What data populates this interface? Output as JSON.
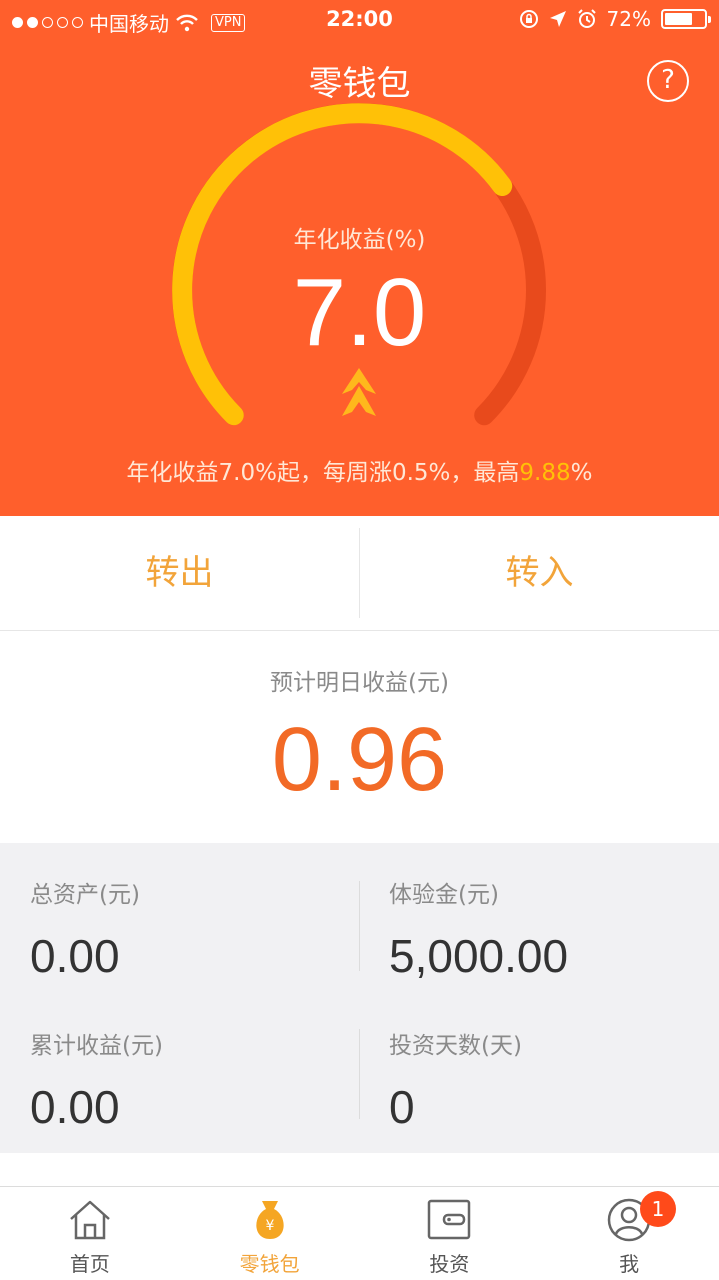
{
  "status_bar": {
    "carrier": "中国移动",
    "vpn": "VPN",
    "time": "22:00",
    "battery": "72%",
    "battery_level": 0.72
  },
  "header": {
    "title": "零钱包",
    "help_icon": "question-circle-icon"
  },
  "gauge": {
    "label": "年化收益(%)",
    "value": "7.0",
    "fill_fraction": 0.7,
    "note_prefix": "年化收益7.0%起，每周涨0.5%，最高",
    "note_highlight": "9.88",
    "note_suffix": "%",
    "colors": {
      "active": "#ffc107",
      "inactive": "#e84a1c"
    }
  },
  "actions": {
    "withdraw": "转出",
    "deposit": "转入"
  },
  "estimate": {
    "label": "预计明日收益(元)",
    "value": "0.96"
  },
  "stats": {
    "total_assets": {
      "label": "总资产(元)",
      "value": "0.00"
    },
    "trial_funds": {
      "label": "体验金(元)",
      "value": "5,000.00"
    },
    "cumulative_earnings": {
      "label": "累计收益(元)",
      "value": "0.00"
    },
    "investment_days": {
      "label": "投资天数(天)",
      "value": "0"
    }
  },
  "tabbar": {
    "tabs": [
      {
        "label": "首页",
        "icon": "home-icon"
      },
      {
        "label": "零钱包",
        "icon": "money-bag-icon"
      },
      {
        "label": "投资",
        "icon": "wallet-icon"
      },
      {
        "label": "我",
        "icon": "user-icon"
      }
    ],
    "active_index": 1,
    "badge": "1"
  },
  "colors": {
    "brand": "#ff5f2c",
    "accent": "#f2a43a",
    "estimate": "#f26a26"
  }
}
